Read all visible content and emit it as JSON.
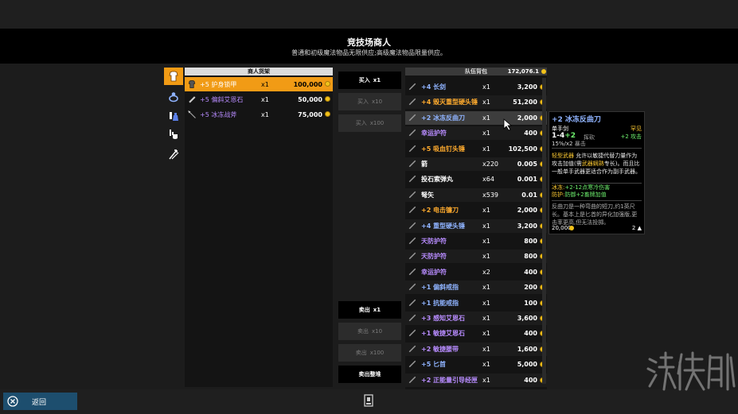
{
  "header": {
    "title": "竞技场商人",
    "subtitle": "普通和初级魔法物品无限供应;高级魔法物品限量供应。"
  },
  "side_tabs": [
    {
      "icon": "armor-icon",
      "active": true
    },
    {
      "icon": "ring-icon",
      "active": false
    },
    {
      "icon": "potion-icon",
      "active": false
    },
    {
      "icon": "hand-icon",
      "active": false
    },
    {
      "icon": "arrows-icon",
      "active": false
    }
  ],
  "merchant": {
    "title": "商人货架",
    "items": [
      {
        "icon": "armor-icon",
        "name": "+5 护身锁甲",
        "qty": "x1",
        "price": "100,000",
        "color": "white"
      },
      {
        "icon": "stone-icon",
        "name": "+5 偏斜艾恩石",
        "qty": "x1",
        "price": "50,000",
        "color": "purple"
      },
      {
        "icon": "spear-icon",
        "name": "+5 冰冻战斧",
        "qty": "x1",
        "price": "75,000",
        "color": "purple"
      }
    ]
  },
  "buttons": {
    "buy_1": "买入",
    "buy_1_x": "x1",
    "buy_10": "买入",
    "buy_10_x": "x10",
    "buy_100": "买入",
    "buy_100_x": "x100",
    "sell_1": "卖出",
    "sell_1_x": "x1",
    "sell_10": "卖出",
    "sell_10_x": "x10",
    "sell_100": "卖出",
    "sell_100_x": "x100",
    "sell_stack": "卖出整堆"
  },
  "inventory": {
    "title": "队伍背包",
    "gold": "172,076.1",
    "items": [
      {
        "name": "+4 长剑",
        "qty": "x1",
        "price": "3,200",
        "color": "blue"
      },
      {
        "name": "+4 毁灭重型硬头锤",
        "qty": "x1",
        "price": "51,200",
        "color": "orange"
      },
      {
        "name": "+2 冰冻反曲刀",
        "qty": "x1",
        "price": "2,000",
        "color": "blue"
      },
      {
        "name": "幸运护符",
        "qty": "x1",
        "price": "400",
        "color": "purple"
      },
      {
        "name": "+5 吸血钉头锤",
        "qty": "x1",
        "price": "102,500",
        "color": "orange"
      },
      {
        "name": "箭",
        "qty": "x220",
        "price": "0.005",
        "color": "white"
      },
      {
        "name": "投石索弹丸",
        "qty": "x64",
        "price": "0.001",
        "color": "white"
      },
      {
        "name": "弩矢",
        "qty": "x539",
        "price": "0.01",
        "color": "white"
      },
      {
        "name": "+2 电击镰刀",
        "qty": "x1",
        "price": "2,000",
        "color": "orange"
      },
      {
        "name": "+4 重型硬头锤",
        "qty": "x1",
        "price": "3,200",
        "color": "blue"
      },
      {
        "name": "天防护符",
        "qty": "x1",
        "price": "800",
        "color": "purple"
      },
      {
        "name": "天防护符",
        "qty": "x1",
        "price": "800",
        "color": "purple"
      },
      {
        "name": "幸运护符",
        "qty": "x2",
        "price": "400",
        "color": "purple"
      },
      {
        "name": "+1 偏斜戒指",
        "qty": "x1",
        "price": "200",
        "color": "blue"
      },
      {
        "name": "+1 抗能戒指",
        "qty": "x1",
        "price": "100",
        "color": "blue"
      },
      {
        "name": "+3 感知艾恩石",
        "qty": "x1",
        "price": "3,600",
        "color": "purple"
      },
      {
        "name": "+1 敏捷艾恩石",
        "qty": "x1",
        "price": "400",
        "color": "purple"
      },
      {
        "name": "+2 敏捷腰带",
        "qty": "x1",
        "price": "1,600",
        "color": "purple"
      },
      {
        "name": "+5 匕首",
        "qty": "x1",
        "price": "5,000",
        "color": "blue"
      },
      {
        "name": "+2 正能量引导经匣",
        "qty": "x1",
        "price": "400",
        "color": "purple"
      }
    ]
  },
  "tooltip": {
    "title": "+2 冰冻反曲刀",
    "type": "单手剑",
    "rarity": "罕见",
    "damage": "1-4",
    "damage_bonus": "+2",
    "damage_label": "挥砍",
    "attack_bonus": "+2 攻击",
    "crit": "15%/x2",
    "crit_label": "暴击",
    "desc_kw": "轻型武器",
    "desc_1": "允许以敏捷代替力量作为攻击加值(需",
    "desc_kw2": "武器娴熟",
    "desc_2": "专长)。而且比一般单手武器更适合作为副手武器。",
    "ench_1_k": "冰冻:",
    "ench_1_v": "+2-12点寒冷伤害",
    "ench_2_k": "防护:",
    "ench_2_v": "防御+2畜牌加值",
    "flavor": "反曲刀是一种弯曲的短刀,约1英尺长。基本上是匕首的异化加强版,更击率更高,但无法投掷。",
    "value": "20,000",
    "weight": "2"
  },
  "footer": {
    "back_label": "返回"
  },
  "watermark": "游侠网"
}
